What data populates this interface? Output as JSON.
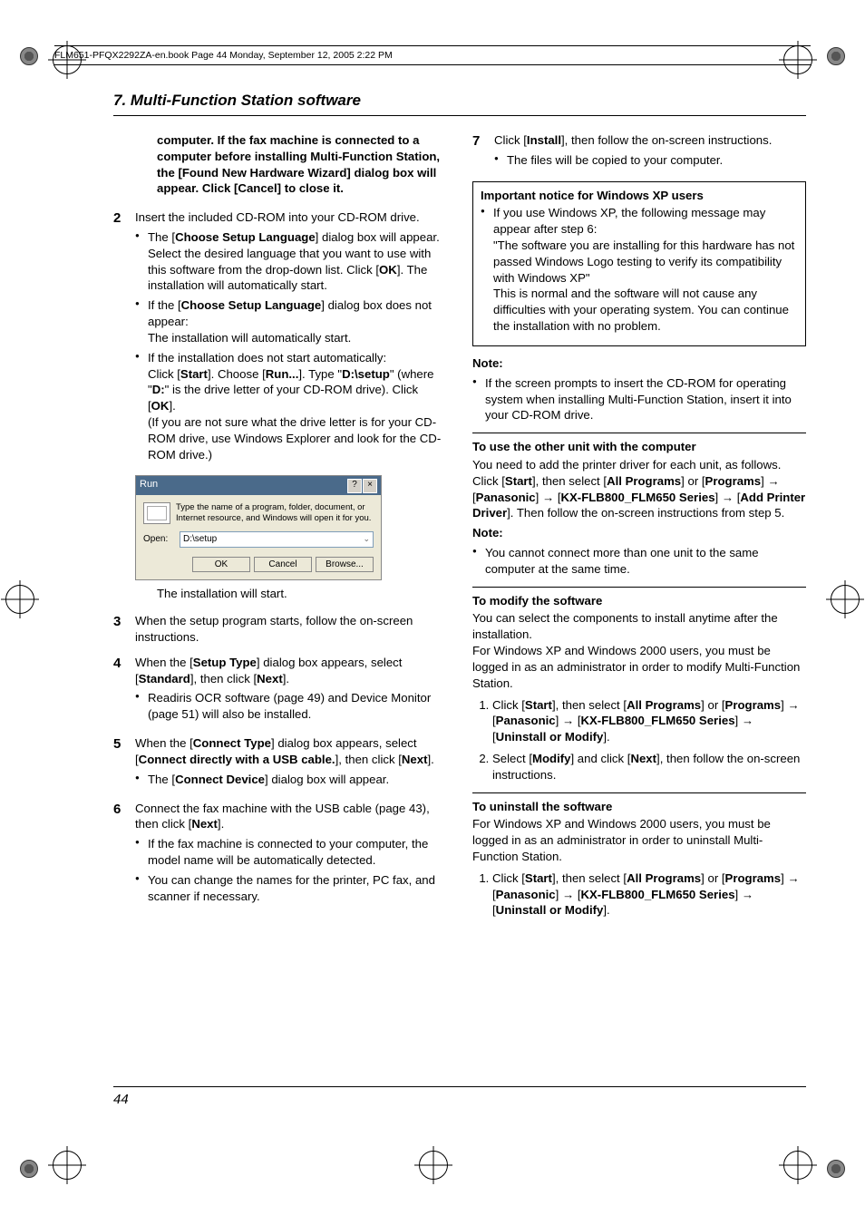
{
  "header": {
    "filename_line": "FLM651-PFQX2292ZA-en.book  Page 44  Monday, September 12, 2005  2:22 PM"
  },
  "section_title": "7. Multi-Function Station software",
  "page_number": "44",
  "left": {
    "intro_bold": "computer. If the fax machine is connected to a computer before installing Multi-Function Station, the [Found New Hardware Wizard] dialog box will appear. Click [Cancel] to close it.",
    "step2_num": "2",
    "step2_text": "Insert the included CD-ROM into your CD-ROM drive.",
    "step2_b1_a": "The [",
    "step2_b1_b": "Choose Setup Language",
    "step2_b1_c": "] dialog box will appear. Select the desired language that you want to use with this software from the drop-down list. Click [",
    "step2_b1_d": "OK",
    "step2_b1_e": "]. The installation will automatically start.",
    "step2_b2_a": "If the [",
    "step2_b2_b": "Choose Setup Language",
    "step2_b2_c": "] dialog box does not appear:",
    "step2_b2_d": "The installation will automatically start.",
    "step2_b3_a": "If the installation does not start automatically:",
    "step2_b3_b": "Click [",
    "step2_b3_c": "Start",
    "step2_b3_d": "]. Choose [",
    "step2_b3_e": "Run...",
    "step2_b3_f": "]. Type \"",
    "step2_b3_g": "D:\\setup",
    "step2_b3_h": "\" (where \"",
    "step2_b3_i": "D:",
    "step2_b3_j": "\" is the drive letter of your CD-ROM drive). Click [",
    "step2_b3_k": "OK",
    "step2_b3_l": "].",
    "step2_b3_m": "(If you are not sure what the drive letter is for your CD-ROM drive, use Windows Explorer and look for the CD-ROM drive.)",
    "run": {
      "title": "Run",
      "desc": "Type the name of a program, folder, document, or Internet resource, and Windows will open it for you.",
      "open_label": "Open:",
      "value": "D:\\setup",
      "ok": "OK",
      "cancel": "Cancel",
      "browse": "Browse..."
    },
    "step2_after": "The installation will start.",
    "step3_num": "3",
    "step3_text": "When the setup program starts, follow the on-screen instructions.",
    "step4_num": "4",
    "step4_a": "When the [",
    "step4_b": "Setup Type",
    "step4_c": "] dialog box appears, select [",
    "step4_d": "Standard",
    "step4_e": "], then click [",
    "step4_f": "Next",
    "step4_g": "].",
    "step4_bullet": "Readiris OCR software (page 49) and Device Monitor (page 51) will also be installed.",
    "step5_num": "5",
    "step5_a": "When the [",
    "step5_b": "Connect Type",
    "step5_c": "] dialog box appears, select [",
    "step5_d": "Connect directly with a USB cable.",
    "step5_e": "], then click [",
    "step5_f": "Next",
    "step5_g": "].",
    "step5_bullet_a": "The [",
    "step5_bullet_b": "Connect Device",
    "step5_bullet_c": "] dialog box will appear.",
    "step6_num": "6",
    "step6_a": "Connect the fax machine with the USB cable (page 43), then click [",
    "step6_b": "Next",
    "step6_c": "].",
    "step6_bullet1": "If the fax machine is connected to your computer, the model name will be automatically detected.",
    "step6_bullet2": "You can change the names for the printer, PC fax, and scanner if necessary."
  },
  "right": {
    "step7_num": "7",
    "step7_a": "Click [",
    "step7_b": "Install",
    "step7_c": "], then follow the on-screen instructions.",
    "step7_bullet": "The files will be copied to your computer.",
    "notice_title": "Important notice for Windows XP users",
    "notice_b1a": "If you use Windows XP, the following message may appear after step 6:",
    "notice_b1b": "\"The software you are installing for this hardware has not passed Windows Logo testing to verify its compatibility with Windows XP\"",
    "notice_b1c": "This is normal and the software will not cause any difficulties with your operating system. You can continue the installation with no problem.",
    "note1_label": "Note:",
    "note1_text": "If the screen prompts to insert the CD-ROM for operating system when installing Multi-Function Station, insert it into your CD-ROM drive.",
    "other_unit_head": "To use the other unit with the computer",
    "other_unit_p1": "You need to add the printer driver for each unit, as follows.",
    "other_unit_p2a": "Click [",
    "other_unit_p2b": "Start",
    "other_unit_p2c": "], then select [",
    "other_unit_p2d": "All Programs",
    "other_unit_p2e": "] or [",
    "other_unit_p2f": "Programs",
    "other_unit_p2g": "] → [",
    "other_unit_p2h": "Panasonic",
    "other_unit_p2i": "] → [",
    "other_unit_p2j": "KX-FLB800_FLM650 Series",
    "other_unit_p2k": "] → [",
    "other_unit_p2l": "Add Printer Driver",
    "other_unit_p2m": "]. Then follow the on-screen instructions from step 5.",
    "note2_label": "Note:",
    "note2_text": "You cannot connect more than one unit to the same computer at the same time.",
    "modify_head": "To modify the software",
    "modify_p1": "You can select the components to install anytime after the installation.",
    "modify_p2": "For Windows XP and Windows 2000 users, you must be logged in as an administrator in order to modify Multi-Function Station.",
    "modify_li1_a": "Click [",
    "modify_li1_b": "Start",
    "modify_li1_c": "], then select [",
    "modify_li1_d": "All Programs",
    "modify_li1_e": "] or [",
    "modify_li1_f": "Programs",
    "modify_li1_g": "] → [",
    "modify_li1_h": "Panasonic",
    "modify_li1_i": "] → [",
    "modify_li1_j": "KX-FLB800_FLM650 Series",
    "modify_li1_k": "] → [",
    "modify_li1_l": "Uninstall or Modify",
    "modify_li1_m": "].",
    "modify_li2_a": "Select [",
    "modify_li2_b": "Modify",
    "modify_li2_c": "] and click [",
    "modify_li2_d": "Next",
    "modify_li2_e": "], then follow the on-screen instructions.",
    "uninstall_head": "To uninstall the software",
    "uninstall_p1": "For Windows XP and Windows 2000 users, you must be logged in as an administrator in order to uninstall Multi-Function Station.",
    "uninstall_li1_a": "Click [",
    "uninstall_li1_b": "Start",
    "uninstall_li1_c": "], then select [",
    "uninstall_li1_d": "All Programs",
    "uninstall_li1_e": "] or [",
    "uninstall_li1_f": "Programs",
    "uninstall_li1_g": "] → [",
    "uninstall_li1_h": "Panasonic",
    "uninstall_li1_i": "] → [",
    "uninstall_li1_j": "KX-FLB800_FLM650 Series",
    "uninstall_li1_k": "] → [",
    "uninstall_li1_l": "Uninstall or Modify",
    "uninstall_li1_m": "]."
  }
}
